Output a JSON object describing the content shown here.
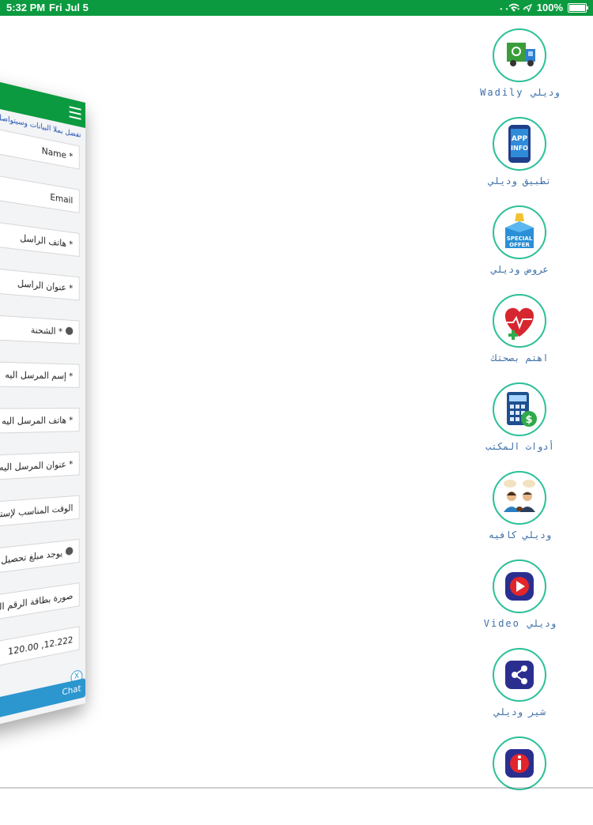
{
  "status": {
    "time": "5:32 PM",
    "date": "Fri Jul 5",
    "battery": "100%"
  },
  "menu": {
    "items": [
      {
        "label": "Wadily وديلي",
        "icon": "delivery-truck-icon"
      },
      {
        "label": "تطبيق وديلي",
        "icon": "app-info-phone-icon"
      },
      {
        "label": "عروض وديلي",
        "icon": "special-offer-box-icon"
      },
      {
        "label": "اهتم بصحتك",
        "icon": "health-heart-icon"
      },
      {
        "label": "أدوات المكتب",
        "icon": "calculator-dollar-icon"
      },
      {
        "label": "وديلي كافيه",
        "icon": "cafe-people-icon"
      },
      {
        "label": "Video وديلي",
        "icon": "video-play-icon"
      },
      {
        "label": "شير وديلي",
        "icon": "share-icon"
      },
      {
        "label": "",
        "icon": "info-icon"
      }
    ]
  },
  "form": {
    "intro": "تفضل بملأ البيانات وسيتواصل",
    "fields": [
      {
        "label": "Name *"
      },
      {
        "label": "Email"
      },
      {
        "label": "هاتف الراسل *"
      },
      {
        "label": "عنوان الراسل *"
      },
      {
        "label": "الشحنة *"
      },
      {
        "label": "إسم المرسل اليه *"
      },
      {
        "label": "هاتف المرسل اليه *"
      },
      {
        "label": "عنوان المرسل اليه *"
      },
      {
        "label": "الوقت المناسب لإستلام ال"
      },
      {
        "label": "يوجد مبلغ تحصيل عن"
      },
      {
        "label": "صورة بطاقة الرقم القومي"
      },
      {
        "label": "120.00 ,12.222"
      }
    ],
    "chat_label": "Chat",
    "close_label": "X"
  }
}
